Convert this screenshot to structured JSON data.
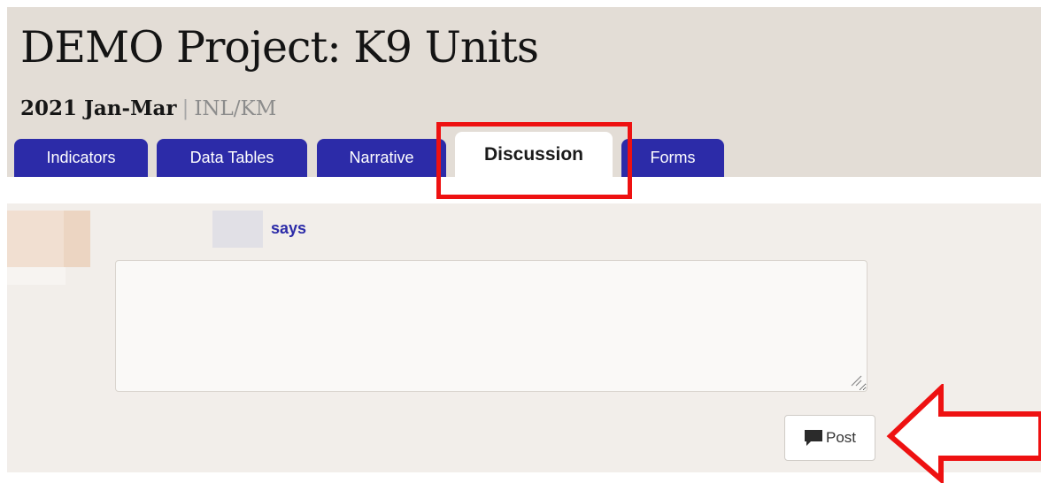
{
  "project": {
    "title": "DEMO Project: K9 Units",
    "period": "2021 Jan-Mar",
    "separator": "|",
    "org": "INL/KM"
  },
  "tabs": [
    {
      "label": "Indicators",
      "active": false
    },
    {
      "label": "Data Tables",
      "active": false
    },
    {
      "label": "Narrative",
      "active": false
    },
    {
      "label": "Discussion",
      "active": true
    },
    {
      "label": "Forms",
      "active": false
    }
  ],
  "discussion": {
    "says_label": "says",
    "comment_value": "",
    "post_label": "Post",
    "post_icon": "comment-icon"
  },
  "colors": {
    "tab_blue": "#2c2ba8",
    "header_bg": "#e3ddd6",
    "panel_bg": "#f2eeea",
    "highlight_red": "#ee1111"
  }
}
